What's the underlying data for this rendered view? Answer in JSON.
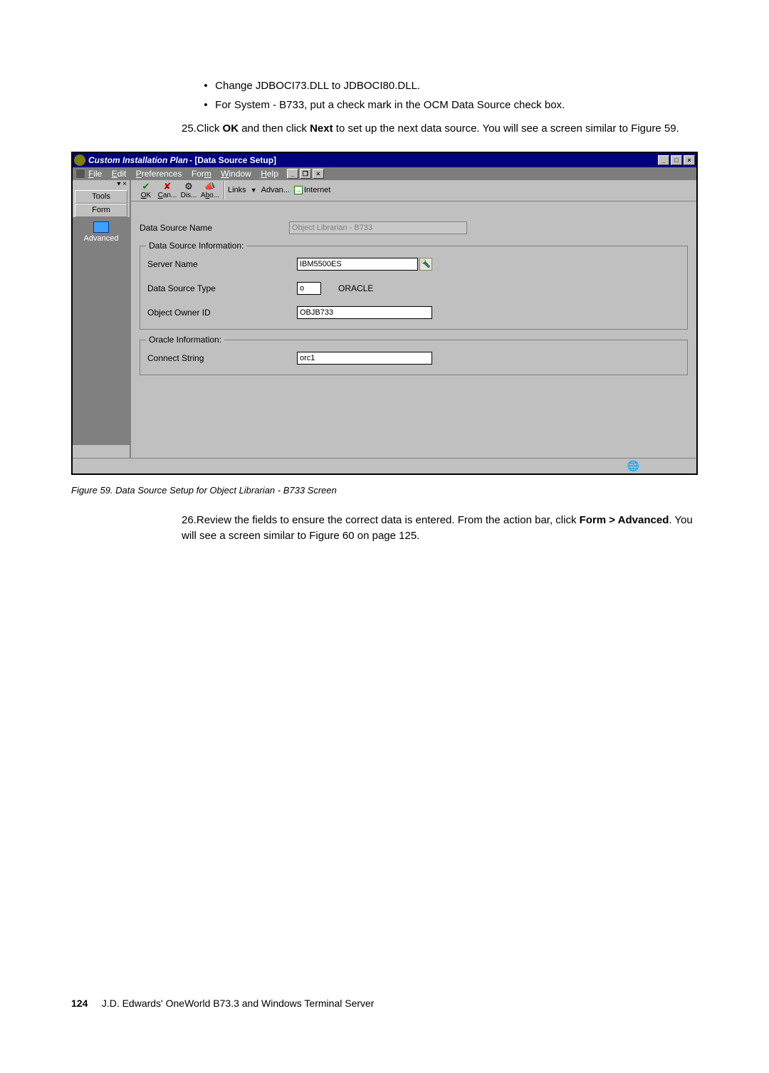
{
  "bullets": {
    "b1": "Change JDBOCI73.DLL to JDBOCI80.DLL.",
    "b2": "For System - B733, put a check mark in the OCM Data Source check box."
  },
  "step25": {
    "num": "25.",
    "part1": "Click ",
    "ok": "OK",
    "part2": " and then click ",
    "next": "Next",
    "part3": " to set up the next data source. You will see a screen similar to Figure 59."
  },
  "win": {
    "title_italic": "Custom Installation Plan",
    "title_rest": " - [Data Source Setup]",
    "menu": {
      "file": "File",
      "edit": "Edit",
      "prefs": "Preferences",
      "form": "Form",
      "window": "Window",
      "help": "Help"
    },
    "winbtns": {
      "min": "_",
      "max": "□",
      "close": "×",
      "restore": "❐"
    },
    "tabs": {
      "tools": "Tools",
      "form": "Form"
    },
    "advanced": "Advanced",
    "toolbar": {
      "ok": "OK",
      "can": "Can...",
      "dis": "Dis...",
      "abo": "Abo...",
      "links": "Links",
      "advan": "Advan...",
      "internet": "Internet"
    },
    "fields": {
      "dsn_label": "Data Source Name",
      "dsn_value": "Object Librarian - B733",
      "group_dsi": "Data Source Information:",
      "server_label": "Server Name",
      "server_value": "IBM5500ES",
      "dst_label": "Data Source Type",
      "dst_code": "o",
      "dst_name": "ORACLE",
      "owner_label": "Object Owner ID",
      "owner_value": "OBJB733",
      "group_oracle": "Oracle Information:",
      "connect_label": "Connect String",
      "connect_value": "orc1"
    }
  },
  "caption": "Figure 59. Data Source Setup for Object Librarian - B733 Screen",
  "step26": {
    "num": "26.",
    "part1": "Review the fields to ensure the correct data is entered. From the action bar, click ",
    "formadv": "Form > Advanced",
    "part2": ". You will see a screen similar to Figure 60 on page 125."
  },
  "footer": {
    "page": "124",
    "text": "J.D. Edwards' OneWorld B73.3 and Windows Terminal Server"
  }
}
